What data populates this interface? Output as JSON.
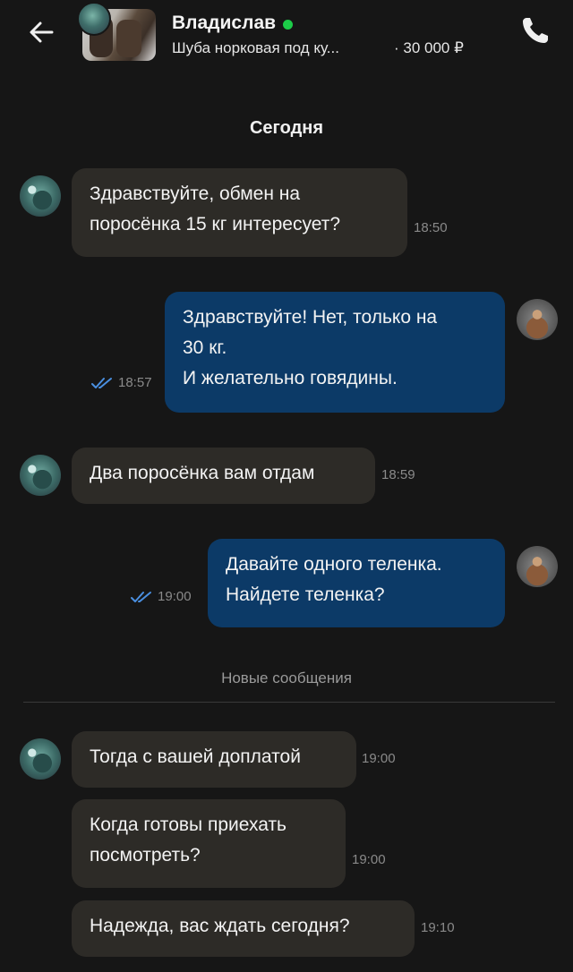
{
  "header": {
    "title": "Владислав",
    "subtitle": "Шуба норковая под ку...",
    "price": "· 30 000 ₽",
    "online_color": "#1ccc48",
    "back_icon": "arrow-left-icon",
    "call_icon": "phone-icon"
  },
  "date_separator": "Сегодня",
  "new_messages_label": "Новые сообщения",
  "messages": [
    {
      "side": "in",
      "text": "Здравствуйте, обмен на\nпоросёнка 15 кг интересует?",
      "time": "18:50"
    },
    {
      "side": "out",
      "text": "Здравствуйте! Нет, только на\n30 кг.\nИ желательно говядины.",
      "time": "18:57",
      "read": true
    },
    {
      "side": "in",
      "text": "Два поросёнка вам отдам",
      "time": "18:59"
    },
    {
      "side": "out",
      "text": "Давайте одного теленка.\nНайдете теленка?",
      "time": "19:00",
      "read": true
    },
    {
      "side": "in",
      "text": "Тогда с вашей доплатой",
      "time": "19:00"
    },
    {
      "side": "in",
      "text": "Когда готовы приехать\nпосмотреть?",
      "time": "19:00"
    },
    {
      "side": "in",
      "text": "Надежда, вас ждать сегодня?",
      "time": "19:10"
    }
  ],
  "colors": {
    "background": "#161616",
    "incoming_bubble": "#2d2b27",
    "outgoing_bubble": "#0c3a67",
    "read_ticks": "#4a8fe0",
    "timestamp": "#8a8a8a"
  }
}
